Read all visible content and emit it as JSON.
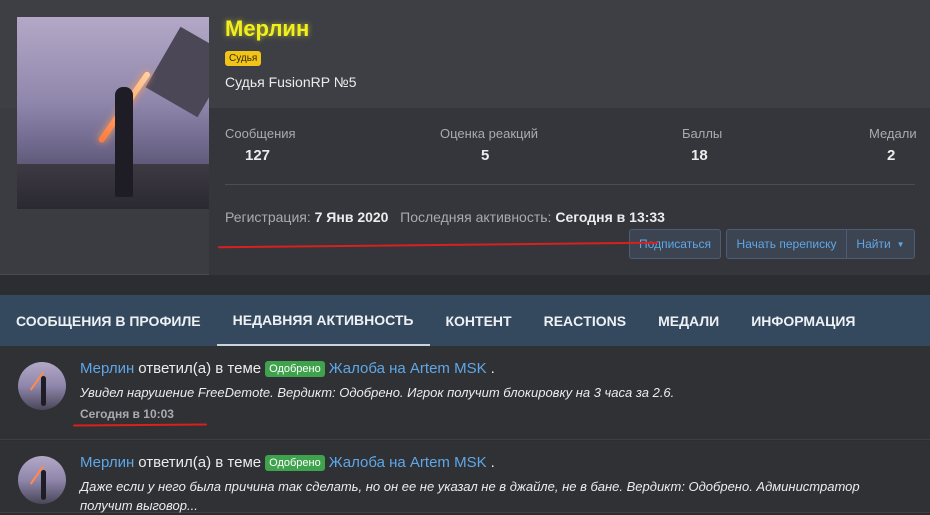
{
  "profile": {
    "name": "Мерлин",
    "role_badge": "Судья",
    "subtitle": "Судья FusionRP №5",
    "stats": [
      {
        "label": "Сообщения",
        "value": "127"
      },
      {
        "label": "Оценка реакций",
        "value": "5"
      },
      {
        "label": "Баллы",
        "value": "18"
      },
      {
        "label": "Медали",
        "value": "2"
      }
    ],
    "registration_label": "Регистрация:",
    "registration_value": "7 Янв 2020",
    "last_activity_label": "Последняя активность:",
    "last_activity_value": "Сегодня в 13:33",
    "buttons": {
      "subscribe": "Подписаться",
      "start_conversation": "Начать переписку",
      "find": "Найти"
    }
  },
  "tabs": [
    {
      "label": "СООБЩЕНИЯ В ПРОФИЛЕ"
    },
    {
      "label": "НЕДАВНЯЯ АКТИВНОСТЬ",
      "active": true
    },
    {
      "label": "КОНТЕНТ"
    },
    {
      "label": "REACTIONS"
    },
    {
      "label": "МЕДАЛИ"
    },
    {
      "label": "ИНФОРМАЦИЯ"
    }
  ],
  "feed": [
    {
      "user": "Мерлин",
      "action": "ответил(а) в теме",
      "status": "Одобрено",
      "thread": "Жалоба на Artem MSK",
      "snippet": "Увидел нарушение FreeDemote. Вердикт: Одобрено. Игрок получит блокировку на 3 часа за 2.6.",
      "time": "Сегодня в 10:03"
    },
    {
      "user": "Мерлин",
      "action": "ответил(а) в теме",
      "status": "Одобрено",
      "thread": "Жалоба на Artem MSK",
      "snippet": "Даже если у него была причина так сделать, но он ее не указал не в джайле, не в бане. Вердикт: Одобрено. Администратор получит выговор..."
    }
  ],
  "colors": {
    "name": "#f2ef1e",
    "badge": "#f0c419",
    "link": "#5fa7e8",
    "status_ok": "#3fa34d",
    "tabs_bg": "#34495e",
    "annotation": "#d8201c"
  }
}
